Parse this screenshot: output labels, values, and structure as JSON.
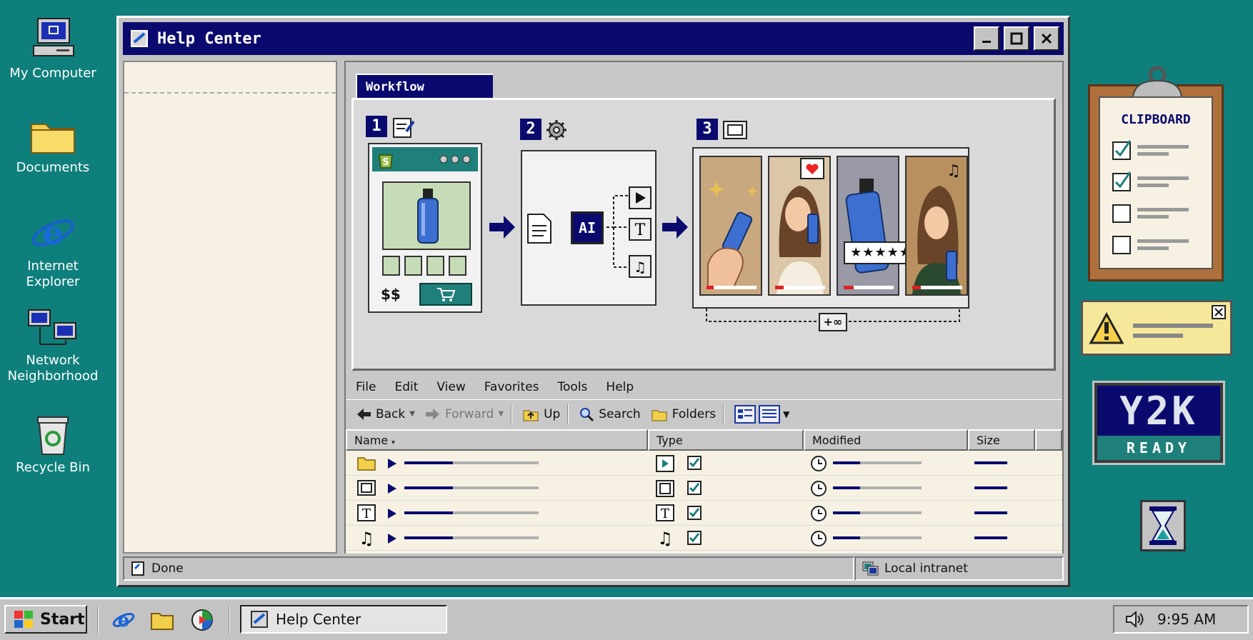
{
  "desktop": {
    "icons": [
      {
        "label_line1": "My Computer",
        "label_line2": ""
      },
      {
        "label_line1": "Documents",
        "label_line2": ""
      },
      {
        "label_line1": "Internet",
        "label_line2": "Explorer"
      },
      {
        "label_line1": "Network",
        "label_line2": "Neighborhood"
      },
      {
        "label_line1": "Recycle Bin",
        "label_line2": ""
      }
    ]
  },
  "window": {
    "title": "Help Center",
    "tab_label": "Workflow",
    "workflow": {
      "steps": [
        "1",
        "2",
        "3"
      ],
      "product_price": "$$",
      "ai_label": "AI",
      "rating_stars": "★★★★★",
      "infinity_label": "+∞"
    },
    "menu": [
      "File",
      "Edit",
      "View",
      "Favorites",
      "Tools",
      "Help"
    ],
    "toolbar": {
      "back": "Back",
      "forward": "Forward",
      "up": "Up",
      "search": "Search",
      "folders": "Folders"
    },
    "columns": [
      "Name",
      "Type",
      "Modified",
      "Size"
    ],
    "rows": [
      {
        "icon": "folder-icon",
        "type_icon": "play-icon",
        "checked": true
      },
      {
        "icon": "film-icon",
        "type_icon": "film-icon",
        "checked": true
      },
      {
        "icon": "text-icon",
        "type_icon": "text-icon",
        "checked": true
      },
      {
        "icon": "music-icon",
        "type_icon": "music-icon",
        "checked": true
      }
    ],
    "status": {
      "left": "Done",
      "right": "Local intranet"
    }
  },
  "widgets": {
    "clipboard_title": "CLIPBOARD",
    "clipboard_items": [
      true,
      true,
      false,
      false
    ],
    "y2k_big": "Y2K",
    "y2k_small": "READY"
  },
  "taskbar": {
    "start_label": "Start",
    "active_task": "Help Center",
    "clock": "9:95 AM"
  },
  "colors": {
    "desktop": "#0f7f7c",
    "titlebar": "#0a0a6e",
    "accent_teal": "#1f7f7b"
  }
}
